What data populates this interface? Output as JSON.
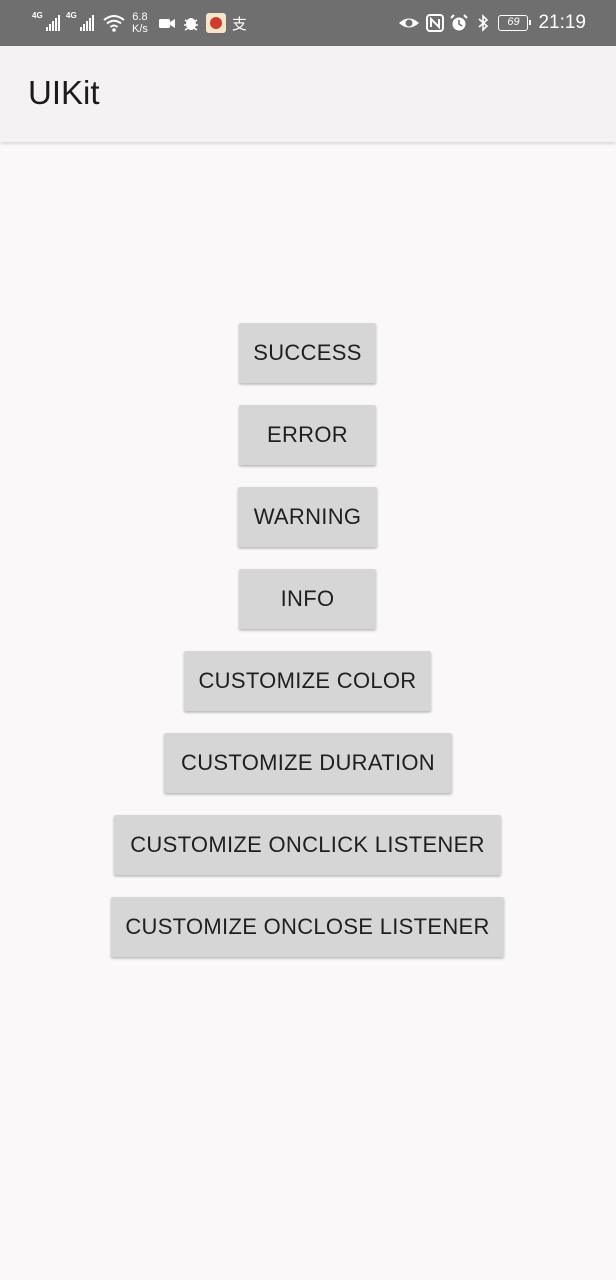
{
  "status_bar": {
    "signal1_tag": "4G",
    "signal2_tag": "4G",
    "speed_value": "6.8",
    "speed_unit": "K/s",
    "battery": "69",
    "time": "21:19",
    "icons": [
      "signal-icon",
      "wifi-icon",
      "video-icon",
      "bug-icon",
      "app-icon",
      "alipay-icon",
      "eye-icon",
      "nfc-icon",
      "alarm-icon",
      "bluetooth-icon",
      "battery-icon"
    ]
  },
  "app_bar": {
    "title": "UIKit"
  },
  "buttons": {
    "success": "SUCCESS",
    "error": "ERROR",
    "warning": "WARNING",
    "info": "INFO",
    "customize_color": "CUSTOMIZE COLOR",
    "customize_duration": "CUSTOMIZE DURATION",
    "customize_onclick": "CUSTOMIZE ONCLICK LISTENER",
    "customize_onclose": "CUSTOMIZE ONCLOSE LISTENER"
  },
  "colors": {
    "status_bar_bg": "#6f6f6f",
    "app_bar_bg": "#f4f2f3",
    "page_bg": "#faf8f9",
    "button_bg": "#d6d6d6",
    "button_text": "#1f1f1f"
  }
}
